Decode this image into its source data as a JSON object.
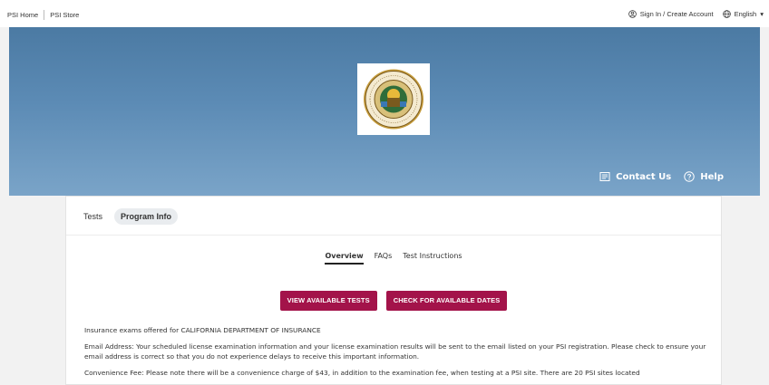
{
  "topbar": {
    "home_link": "PSI Home",
    "store_link": "PSI Store",
    "sign_in": "Sign In / Create Account",
    "language": "English",
    "language_caret": "▾"
  },
  "hero": {
    "seal_text_top": "DEPARTMENT OF INSURANCE",
    "seal_text_bottom": "STATE OF CALIFORNIA",
    "contact_label": "Contact Us",
    "help_label": "Help"
  },
  "program_tabs": [
    {
      "label": "Tests"
    },
    {
      "label": "Program Info"
    }
  ],
  "sub_tabs": [
    {
      "label": "Overview"
    },
    {
      "label": "FAQs"
    },
    {
      "label": "Test Instructions"
    }
  ],
  "actions": {
    "view_tests": "VIEW AVAILABLE TESTS",
    "check_dates": "CHECK FOR AVAILABLE DATES"
  },
  "content": {
    "intro": "Insurance exams offered for CALIFORNIA DEPARTMENT OF INSURANCE",
    "email_notice": "Email Address: Your scheduled license examination information and your license examination results will be sent to the email listed on your PSI registration. Please check to ensure your email address is correct so that you do not experience delays to receive this important information.",
    "fee_notice": "Convenience Fee: Please note there will be a convenience charge of $43, in addition to the examination fee, when testing at a PSI site. There are 20 PSI sites located"
  },
  "colors": {
    "accent": "#a3134a",
    "hero_top": "#4b7aa3",
    "hero_bottom": "#7aa4c8"
  }
}
